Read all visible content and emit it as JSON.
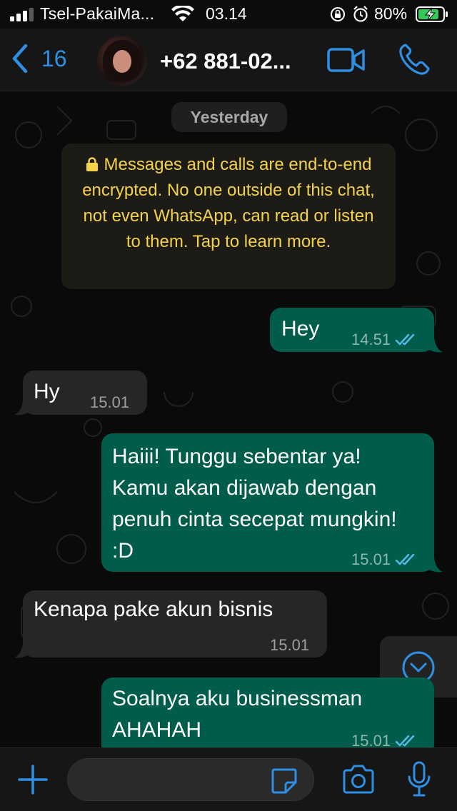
{
  "status_bar": {
    "carrier": "Tsel-PakaiMa...",
    "time": "03.14",
    "battery_percent": "80%"
  },
  "header": {
    "back_count": "16",
    "contact_name": "+62 881-02...",
    "icons": {
      "back": "chevron-left-icon",
      "video": "video-camera-icon",
      "call": "phone-icon"
    }
  },
  "chat": {
    "date_label": "Yesterday",
    "encryption_notice": "Messages and calls are end-to-end encrypted. No one outside of this chat, not even WhatsApp, can read or listen to them. Tap to learn more.",
    "messages": [
      {
        "direction": "outgoing",
        "text": "Hey",
        "time": "14.51",
        "status": "read"
      },
      {
        "direction": "incoming",
        "text": "Hy",
        "time": "15.01"
      },
      {
        "direction": "outgoing",
        "text": "Haiii! Tunggu sebentar ya! Kamu akan dijawab dengan penuh cinta secepat mungkin! :D",
        "time": "15.01",
        "status": "read"
      },
      {
        "direction": "incoming",
        "text": "Kenapa pake akun bisnis",
        "time": "15.01"
      },
      {
        "direction": "outgoing",
        "text": "Soalnya aku businessman AHAHAH",
        "time": "15.01",
        "status": "read"
      }
    ]
  },
  "input_bar": {
    "placeholder": "",
    "icons": {
      "plus": "plus-icon",
      "sticker": "sticker-icon",
      "camera": "camera-icon",
      "mic": "microphone-icon"
    }
  },
  "colors": {
    "accent": "#2f8fe5",
    "outgoing_bubble": "#005c4b",
    "incoming_bubble": "#262626",
    "encryption_text": "#f4d34a",
    "read_ticks": "#53bdeb"
  }
}
